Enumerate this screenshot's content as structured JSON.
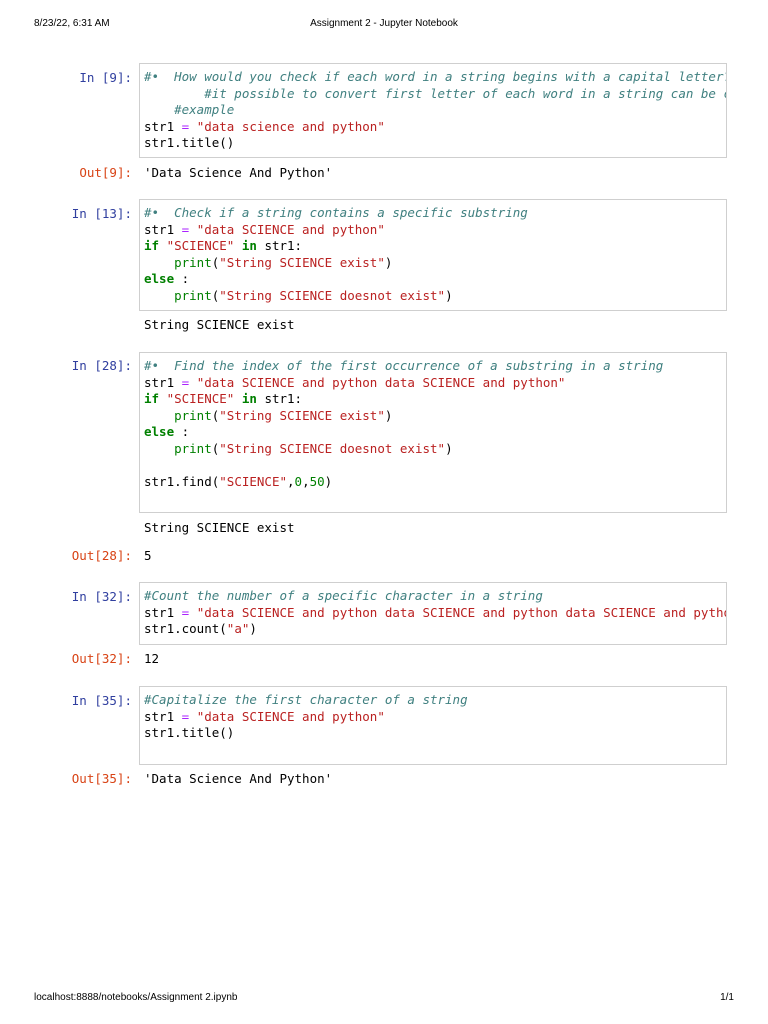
{
  "print_header": {
    "datetime": "8/23/22, 6:31 AM",
    "title": "Assignment 2 - Jupyter Notebook"
  },
  "print_footer": {
    "url": "localhost:8888/notebooks/Assignment 2.ipynb",
    "page": "1/1"
  },
  "cells": [
    {
      "in_prompt": "In [9]:",
      "code": [
        [
          [
            "c",
            "#•  How would you check if each word in a string begins with a capital letter?"
          ]
        ],
        [
          [
            "c",
            "        #it possible to convert first letter of each word in a string can be conv"
          ]
        ],
        [
          [
            "c",
            "    #example"
          ]
        ],
        [
          [
            "t",
            "str1 "
          ],
          [
            "o",
            "="
          ],
          [
            "t",
            " "
          ],
          [
            "s",
            "\"data science and python\""
          ]
        ],
        [
          [
            "t",
            "str1.title()"
          ]
        ]
      ],
      "out_prompt": "Out[9]:",
      "output": "'Data Science And Python'"
    },
    {
      "in_prompt": "In [13]:",
      "code": [
        [
          [
            "c",
            "#•  Check if a string contains a specific substring"
          ]
        ],
        [
          [
            "t",
            "str1 "
          ],
          [
            "o",
            "="
          ],
          [
            "t",
            " "
          ],
          [
            "s",
            "\"data SCIENCE and python\""
          ]
        ],
        [
          [
            "k",
            "if"
          ],
          [
            "t",
            " "
          ],
          [
            "s",
            "\"SCIENCE\""
          ],
          [
            "t",
            " "
          ],
          [
            "k",
            "in"
          ],
          [
            "t",
            " str1:"
          ]
        ],
        [
          [
            "t",
            "    "
          ],
          [
            "b",
            "print"
          ],
          [
            "t",
            "("
          ],
          [
            "s",
            "\"String SCIENCE exist\""
          ],
          [
            "t",
            ")"
          ]
        ],
        [
          [
            "k",
            "else"
          ],
          [
            "t",
            " :"
          ]
        ],
        [
          [
            "t",
            "    "
          ],
          [
            "b",
            "print"
          ],
          [
            "t",
            "("
          ],
          [
            "s",
            "\"String SCIENCE doesnot exist\""
          ],
          [
            "t",
            ")"
          ]
        ]
      ],
      "stream": "String SCIENCE exist"
    },
    {
      "in_prompt": "In [28]:",
      "code": [
        [
          [
            "c",
            "#•  Find the index of the first occurrence of a substring in a string"
          ]
        ],
        [
          [
            "t",
            "str1 "
          ],
          [
            "o",
            "="
          ],
          [
            "t",
            " "
          ],
          [
            "s",
            "\"data SCIENCE and python data SCIENCE and python\""
          ]
        ],
        [
          [
            "k",
            "if"
          ],
          [
            "t",
            " "
          ],
          [
            "s",
            "\"SCIENCE\""
          ],
          [
            "t",
            " "
          ],
          [
            "k",
            "in"
          ],
          [
            "t",
            " str1:"
          ]
        ],
        [
          [
            "t",
            "    "
          ],
          [
            "b",
            "print"
          ],
          [
            "t",
            "("
          ],
          [
            "s",
            "\"String SCIENCE exist\""
          ],
          [
            "t",
            ")"
          ]
        ],
        [
          [
            "k",
            "else"
          ],
          [
            "t",
            " :"
          ]
        ],
        [
          [
            "t",
            "    "
          ],
          [
            "b",
            "print"
          ],
          [
            "t",
            "("
          ],
          [
            "s",
            "\"String SCIENCE doesnot exist\""
          ],
          [
            "t",
            ")"
          ]
        ],
        [
          [
            "t",
            ""
          ]
        ],
        [
          [
            "t",
            "str1.find("
          ],
          [
            "s",
            "\"SCIENCE\""
          ],
          [
            "t",
            ","
          ],
          [
            "n",
            "0"
          ],
          [
            "t",
            ","
          ],
          [
            "n",
            "50"
          ],
          [
            "t",
            ")"
          ]
        ],
        [
          [
            "t",
            ""
          ]
        ]
      ],
      "stream": "String SCIENCE exist",
      "out_prompt": "Out[28]:",
      "output": "5"
    },
    {
      "in_prompt": "In [32]:",
      "code": [
        [
          [
            "c",
            "#Count the number of a specific character in a string"
          ]
        ],
        [
          [
            "t",
            "str1 "
          ],
          [
            "o",
            "="
          ],
          [
            "t",
            " "
          ],
          [
            "s",
            "\"data SCIENCE and python data SCIENCE and python data SCIENCE and python d"
          ]
        ],
        [
          [
            "t",
            "str1.count("
          ],
          [
            "s",
            "\"a\""
          ],
          [
            "t",
            ")"
          ]
        ]
      ],
      "out_prompt": "Out[32]:",
      "output": "12"
    },
    {
      "in_prompt": "In [35]:",
      "code": [
        [
          [
            "c",
            "#Capitalize the first character of a string"
          ]
        ],
        [
          [
            "t",
            "str1 "
          ],
          [
            "o",
            "="
          ],
          [
            "t",
            " "
          ],
          [
            "s",
            "\"data SCIENCE and python\""
          ]
        ],
        [
          [
            "t",
            "str1.title()"
          ]
        ],
        [
          [
            "t",
            ""
          ]
        ]
      ],
      "out_prompt": "Out[35]:",
      "output": "'Data Science And Python'"
    }
  ]
}
